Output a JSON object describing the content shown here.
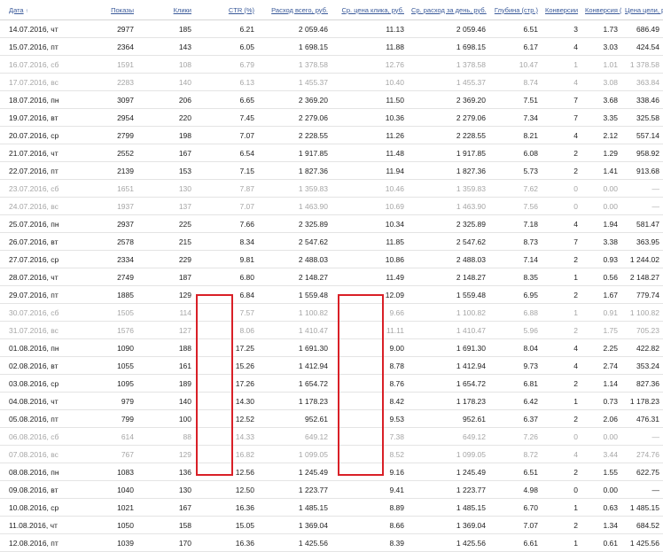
{
  "headers": [
    "Дата",
    "Показы",
    "Клики",
    "CTR (%)",
    "Расход всего, руб.",
    "Ср. цена клика, руб.",
    "Ср. расход за день, руб.",
    "Глубина (стр.)",
    "Конверсии",
    "Конверсия (%)",
    "Цена цели, руб."
  ],
  "sort_indicator": "↑",
  "rows": [
    {
      "weekend": false,
      "cells": [
        "14.07.2016, чт",
        "2977",
        "185",
        "6.21",
        "2 059.46",
        "11.13",
        "2 059.46",
        "6.51",
        "3",
        "1.73",
        "686.49"
      ]
    },
    {
      "weekend": false,
      "cells": [
        "15.07.2016, пт",
        "2364",
        "143",
        "6.05",
        "1 698.15",
        "11.88",
        "1 698.15",
        "6.17",
        "4",
        "3.03",
        "424.54"
      ]
    },
    {
      "weekend": true,
      "cells": [
        "16.07.2016, сб",
        "1591",
        "108",
        "6.79",
        "1 378.58",
        "12.76",
        "1 378.58",
        "10.47",
        "1",
        "1.01",
        "1 378.58"
      ]
    },
    {
      "weekend": true,
      "cells": [
        "17.07.2016, вс",
        "2283",
        "140",
        "6.13",
        "1 455.37",
        "10.40",
        "1 455.37",
        "8.74",
        "4",
        "3.08",
        "363.84"
      ]
    },
    {
      "weekend": false,
      "cells": [
        "18.07.2016, пн",
        "3097",
        "206",
        "6.65",
        "2 369.20",
        "11.50",
        "2 369.20",
        "7.51",
        "7",
        "3.68",
        "338.46"
      ]
    },
    {
      "weekend": false,
      "cells": [
        "19.07.2016, вт",
        "2954",
        "220",
        "7.45",
        "2 279.06",
        "10.36",
        "2 279.06",
        "7.34",
        "7",
        "3.35",
        "325.58"
      ]
    },
    {
      "weekend": false,
      "cells": [
        "20.07.2016, ср",
        "2799",
        "198",
        "7.07",
        "2 228.55",
        "11.26",
        "2 228.55",
        "8.21",
        "4",
        "2.12",
        "557.14"
      ]
    },
    {
      "weekend": false,
      "cells": [
        "21.07.2016, чт",
        "2552",
        "167",
        "6.54",
        "1 917.85",
        "11.48",
        "1 917.85",
        "6.08",
        "2",
        "1.29",
        "958.92"
      ]
    },
    {
      "weekend": false,
      "cells": [
        "22.07.2016, пт",
        "2139",
        "153",
        "7.15",
        "1 827.36",
        "11.94",
        "1 827.36",
        "5.73",
        "2",
        "1.41",
        "913.68"
      ]
    },
    {
      "weekend": true,
      "cells": [
        "23.07.2016, сб",
        "1651",
        "130",
        "7.87",
        "1 359.83",
        "10.46",
        "1 359.83",
        "7.62",
        "0",
        "0.00",
        "—"
      ]
    },
    {
      "weekend": true,
      "cells": [
        "24.07.2016, вс",
        "1937",
        "137",
        "7.07",
        "1 463.90",
        "10.69",
        "1 463.90",
        "7.56",
        "0",
        "0.00",
        "—"
      ]
    },
    {
      "weekend": false,
      "cells": [
        "25.07.2016, пн",
        "2937",
        "225",
        "7.66",
        "2 325.89",
        "10.34",
        "2 325.89",
        "7.18",
        "4",
        "1.94",
        "581.47"
      ]
    },
    {
      "weekend": false,
      "cells": [
        "26.07.2016, вт",
        "2578",
        "215",
        "8.34",
        "2 547.62",
        "11.85",
        "2 547.62",
        "8.73",
        "7",
        "3.38",
        "363.95"
      ]
    },
    {
      "weekend": false,
      "cells": [
        "27.07.2016, ср",
        "2334",
        "229",
        "9.81",
        "2 488.03",
        "10.86",
        "2 488.03",
        "7.14",
        "2",
        "0.93",
        "1 244.02"
      ]
    },
    {
      "weekend": false,
      "cells": [
        "28.07.2016, чт",
        "2749",
        "187",
        "6.80",
        "2 148.27",
        "11.49",
        "2 148.27",
        "8.35",
        "1",
        "0.56",
        "2 148.27"
      ]
    },
    {
      "weekend": false,
      "cells": [
        "29.07.2016, пт",
        "1885",
        "129",
        "6.84",
        "1 559.48",
        "12.09",
        "1 559.48",
        "6.95",
        "2",
        "1.67",
        "779.74"
      ]
    },
    {
      "weekend": true,
      "cells": [
        "30.07.2016, сб",
        "1505",
        "114",
        "7.57",
        "1 100.82",
        "9.66",
        "1 100.82",
        "6.88",
        "1",
        "0.91",
        "1 100.82"
      ]
    },
    {
      "weekend": true,
      "cells": [
        "31.07.2016, вс",
        "1576",
        "127",
        "8.06",
        "1 410.47",
        "11.11",
        "1 410.47",
        "5.96",
        "2",
        "1.75",
        "705.23"
      ]
    },
    {
      "weekend": false,
      "cells": [
        "01.08.2016, пн",
        "1090",
        "188",
        "17.25",
        "1 691.30",
        "9.00",
        "1 691.30",
        "8.04",
        "4",
        "2.25",
        "422.82"
      ]
    },
    {
      "weekend": false,
      "cells": [
        "02.08.2016, вт",
        "1055",
        "161",
        "15.26",
        "1 412.94",
        "8.78",
        "1 412.94",
        "9.73",
        "4",
        "2.74",
        "353.24"
      ]
    },
    {
      "weekend": false,
      "cells": [
        "03.08.2016, ср",
        "1095",
        "189",
        "17.26",
        "1 654.72",
        "8.76",
        "1 654.72",
        "6.81",
        "2",
        "1.14",
        "827.36"
      ]
    },
    {
      "weekend": false,
      "cells": [
        "04.08.2016, чт",
        "979",
        "140",
        "14.30",
        "1 178.23",
        "8.42",
        "1 178.23",
        "6.42",
        "1",
        "0.73",
        "1 178.23"
      ]
    },
    {
      "weekend": false,
      "cells": [
        "05.08.2016, пт",
        "799",
        "100",
        "12.52",
        "952.61",
        "9.53",
        "952.61",
        "6.37",
        "2",
        "2.06",
        "476.31"
      ]
    },
    {
      "weekend": true,
      "cells": [
        "06.08.2016, сб",
        "614",
        "88",
        "14.33",
        "649.12",
        "7.38",
        "649.12",
        "7.26",
        "0",
        "0.00",
        "—"
      ]
    },
    {
      "weekend": true,
      "cells": [
        "07.08.2016, вс",
        "767",
        "129",
        "16.82",
        "1 099.05",
        "8.52",
        "1 099.05",
        "8.72",
        "4",
        "3.44",
        "274.76"
      ]
    },
    {
      "weekend": false,
      "cells": [
        "08.08.2016, пн",
        "1083",
        "136",
        "12.56",
        "1 245.49",
        "9.16",
        "1 245.49",
        "6.51",
        "2",
        "1.55",
        "622.75"
      ]
    },
    {
      "weekend": false,
      "cells": [
        "09.08.2016, вт",
        "1040",
        "130",
        "12.50",
        "1 223.77",
        "9.41",
        "1 223.77",
        "4.98",
        "0",
        "0.00",
        "—"
      ]
    },
    {
      "weekend": false,
      "cells": [
        "10.08.2016, ср",
        "1021",
        "167",
        "16.36",
        "1 485.15",
        "8.89",
        "1 485.15",
        "6.70",
        "1",
        "0.63",
        "1 485.15"
      ]
    },
    {
      "weekend": false,
      "cells": [
        "11.08.2016, чт",
        "1050",
        "158",
        "15.05",
        "1 369.04",
        "8.66",
        "1 369.04",
        "7.07",
        "2",
        "1.34",
        "684.52"
      ]
    },
    {
      "weekend": false,
      "cells": [
        "12.08.2016, пт",
        "1039",
        "170",
        "16.36",
        "1 425.56",
        "8.39",
        "1 425.56",
        "6.61",
        "1",
        "0.61",
        "1 425.56"
      ]
    }
  ],
  "colors": {
    "header_link": "#3a5a9a",
    "weekend_text": "#a6a6a6",
    "highlight_box": "#d92027"
  }
}
